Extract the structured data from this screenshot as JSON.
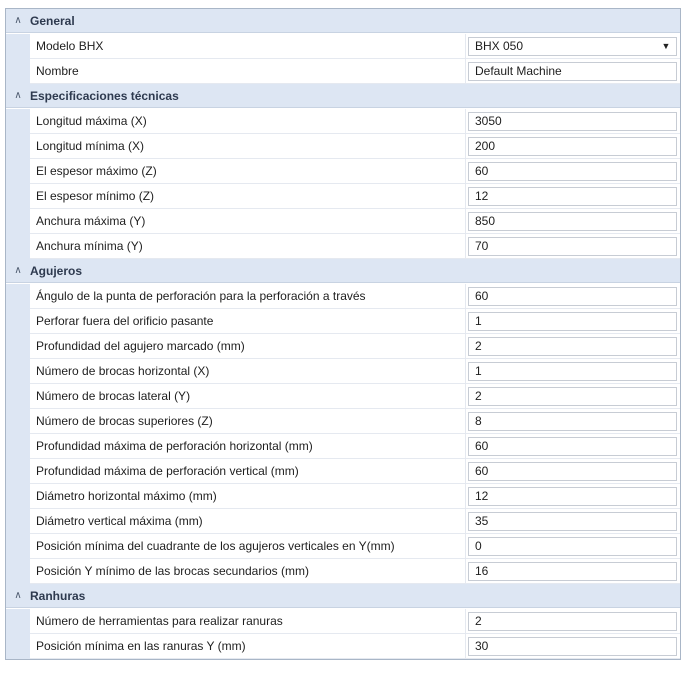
{
  "categories": [
    {
      "title": "General",
      "properties": [
        {
          "name": "Modelo BHX",
          "value": "BHX 050",
          "dropdown": true
        },
        {
          "name": "Nombre",
          "value": "Default Machine"
        }
      ]
    },
    {
      "title": "Especificaciones técnicas",
      "properties": [
        {
          "name": "Longitud máxima (X)",
          "value": "3050"
        },
        {
          "name": "Longitud mínima (X)",
          "value": "200"
        },
        {
          "name": "El espesor máximo (Z)",
          "value": "60"
        },
        {
          "name": "El espesor mínimo (Z)",
          "value": "12"
        },
        {
          "name": "Anchura máxima (Y)",
          "value": "850"
        },
        {
          "name": "Anchura mínima (Y)",
          "value": "70"
        }
      ]
    },
    {
      "title": "Agujeros",
      "properties": [
        {
          "name": "Ángulo de la punta de perforación para la perforación a través",
          "value": "60"
        },
        {
          "name": "Perforar fuera del orificio pasante",
          "value": "1"
        },
        {
          "name": "Profundidad del agujero marcado (mm)",
          "value": "2"
        },
        {
          "name": "Número de brocas horizontal (X)",
          "value": "1"
        },
        {
          "name": "Número de brocas lateral (Y)",
          "value": "2"
        },
        {
          "name": "Número de brocas superiores (Z)",
          "value": "8"
        },
        {
          "name": "Profundidad máxima de perforación horizontal (mm)",
          "value": "60"
        },
        {
          "name": "Profundidad máxima de perforación vertical (mm)",
          "value": "60"
        },
        {
          "name": "Diámetro horizontal máximo (mm)",
          "value": "12"
        },
        {
          "name": "Diámetro vertical máxima (mm)",
          "value": "35"
        },
        {
          "name": "Posición mínima del cuadrante de los agujeros verticales en Y(mm)",
          "value": "0"
        },
        {
          "name": "Posición Y mínimo de las brocas secundarios (mm)",
          "value": "16"
        }
      ]
    },
    {
      "title": "Ranhuras",
      "properties": [
        {
          "name": "Número de herramientas para realizar ranuras",
          "value": "2"
        },
        {
          "name": "Posición mínima en las ranuras Y (mm)",
          "value": "30"
        }
      ]
    }
  ],
  "icons": {
    "collapse": "chevron-up-icon",
    "dropdown": "dropdown-arrow-icon"
  }
}
